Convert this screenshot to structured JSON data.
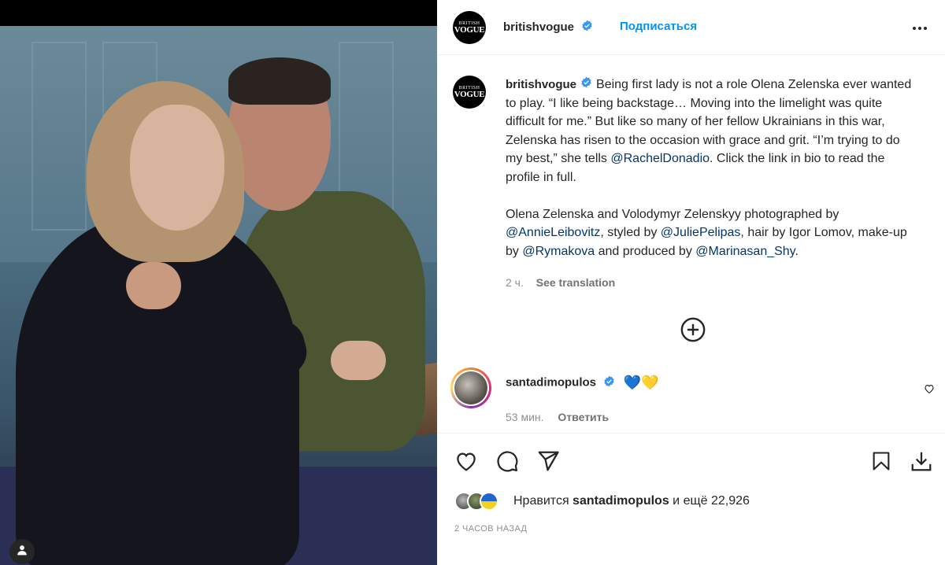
{
  "header": {
    "username": "britishvogue",
    "follow_label": "Подписаться",
    "avatar_line1": "BRITISH",
    "avatar_line2": "VOGUE"
  },
  "caption": {
    "username": "britishvogue",
    "text_1": "Being first lady is not a role Olena Zelenska ever wanted to play. “I like being backstage… Moving into the limelight was quite difficult for me.” But like so many of her fellow Ukrainians in this war, Zelenska has risen to the occasion with grace and grit. “I’m trying to do my best,” she tells ",
    "mention_1": "@RachelDonadio",
    "text_2": ". Click the link in bio to read the profile in full.",
    "text_3": "Olena Zelenska and Volodymyr Zelenskyy photographed by ",
    "mention_2": "@AnnieLeibovitz",
    "text_4": ", styled by ",
    "mention_3": "@JuliePelipas",
    "text_5": ", hair by Igor Lomov, make-up by ",
    "mention_4": "@Rymakova",
    "text_6": " and produced by ",
    "mention_5": "@Marinasan_Shy",
    "text_7": ".",
    "age": "2 ч.",
    "see_translation": "See translation"
  },
  "comment": {
    "username": "santadimopulos",
    "hearts": "💙💛",
    "age": "53 мин.",
    "reply_label": "Ответить"
  },
  "likes": {
    "prefix": "Нравится ",
    "user": "santadimopulos",
    "suffix": " и ещё 22,926"
  },
  "timestamp": "2 ЧАСОВ НАЗАД",
  "icons": [
    "more-icon",
    "verified-icon",
    "add-comment-icon",
    "heart-icon",
    "comment-icon",
    "share-icon",
    "save-icon",
    "download-icon",
    "profile-icon"
  ],
  "colors": {
    "accent": "#0095f6",
    "mention": "#00376b",
    "verified": "#3897f0",
    "muted": "#8e8e8e"
  }
}
